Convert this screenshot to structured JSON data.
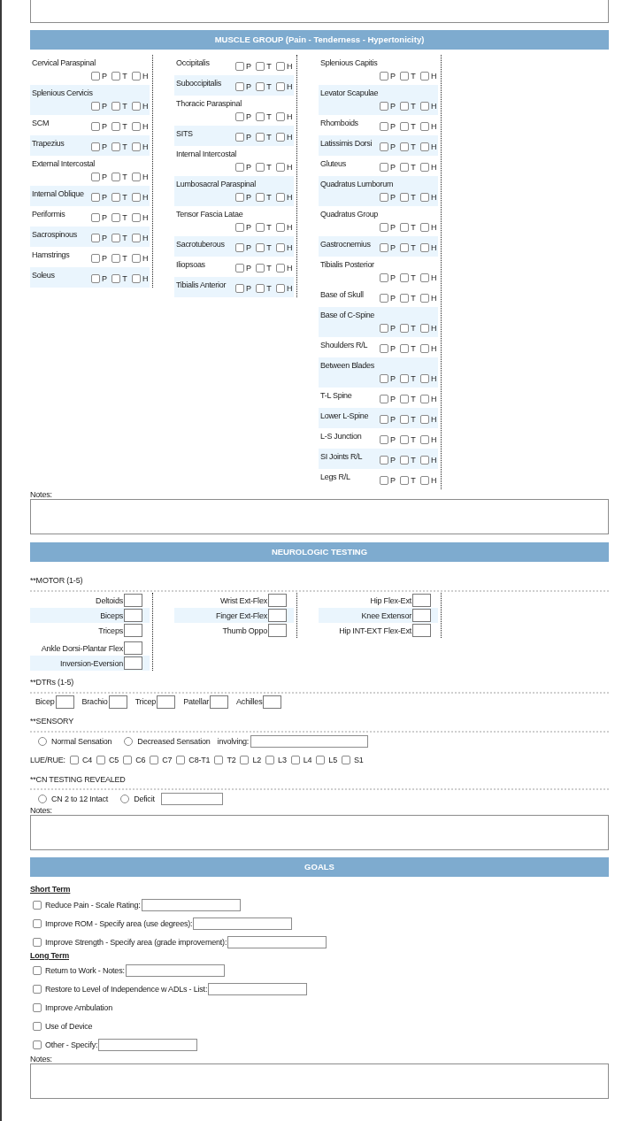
{
  "muscle_group": {
    "title": "MUSCLE GROUP (Pain - Tenderness - Hypertonicity)",
    "columns": [
      {
        "blocks": [
          {
            "rows": [
              {
                "name": "Cervical Paraspinal",
                "checks": [
                  {
                    "label": "P",
                    "checked": false
                  },
                  {
                    "label": "T",
                    "checked": false
                  },
                  {
                    "label": "H",
                    "checked": false
                  }
                ]
              },
              {
                "name": "Splenious Cervicis",
                "checks": [
                  {
                    "label": "P",
                    "checked": false
                  },
                  {
                    "label": "T",
                    "checked": false
                  },
                  {
                    "label": "H",
                    "checked": false
                  }
                ]
              },
              {
                "name": "SCM",
                "checks": [
                  {
                    "label": "P",
                    "checked": false
                  },
                  {
                    "label": "T",
                    "checked": false
                  },
                  {
                    "label": "H",
                    "checked": false
                  }
                ]
              },
              {
                "name": "Trapezius",
                "checks": [
                  {
                    "label": "P",
                    "checked": false
                  },
                  {
                    "label": "T",
                    "checked": false
                  },
                  {
                    "label": "H",
                    "checked": false
                  }
                ]
              },
              {
                "name": "External Intercostal",
                "checks": [
                  {
                    "label": "P",
                    "checked": false
                  },
                  {
                    "label": "T",
                    "checked": false
                  },
                  {
                    "label": "H",
                    "checked": false
                  }
                ]
              },
              {
                "name": "Internal Oblique",
                "checks": [
                  {
                    "label": "P",
                    "checked": false
                  },
                  {
                    "label": "T",
                    "checked": false
                  },
                  {
                    "label": "H",
                    "checked": false
                  }
                ]
              },
              {
                "name": "Periformis",
                "checks": [
                  {
                    "label": "P",
                    "checked": false
                  },
                  {
                    "label": "T",
                    "checked": false
                  },
                  {
                    "label": "H",
                    "checked": false
                  }
                ]
              },
              {
                "name": "Sacrospinous",
                "checks": [
                  {
                    "label": "P",
                    "checked": false
                  },
                  {
                    "label": "T",
                    "checked": false
                  },
                  {
                    "label": "H",
                    "checked": false
                  }
                ]
              },
              {
                "name": "Hamstrings",
                "checks": [
                  {
                    "label": "P",
                    "checked": false
                  },
                  {
                    "label": "T",
                    "checked": false
                  },
                  {
                    "label": "H",
                    "checked": false
                  }
                ]
              },
              {
                "name": "Soleus",
                "checks": [
                  {
                    "label": "P",
                    "checked": false
                  },
                  {
                    "label": "T",
                    "checked": false
                  },
                  {
                    "label": "H",
                    "checked": false
                  }
                ]
              }
            ]
          }
        ]
      },
      {
        "blocks": [
          {
            "rows": [
              {
                "name": "Occipitalis",
                "checks": [
                  {
                    "label": "P",
                    "checked": false
                  },
                  {
                    "label": "T",
                    "checked": false
                  },
                  {
                    "label": "H",
                    "checked": false
                  }
                ]
              },
              {
                "name": "Suboccipitalis",
                "checks": [
                  {
                    "label": "P",
                    "checked": false
                  },
                  {
                    "label": "T",
                    "checked": false
                  },
                  {
                    "label": "H",
                    "checked": false
                  }
                ]
              },
              {
                "name": "Thoracic Paraspinal",
                "checks": [
                  {
                    "label": "P",
                    "checked": false
                  },
                  {
                    "label": "T",
                    "checked": false
                  },
                  {
                    "label": "H",
                    "checked": false
                  }
                ]
              },
              {
                "name": "SITS",
                "checks": [
                  {
                    "label": "P",
                    "checked": false
                  },
                  {
                    "label": "T",
                    "checked": false
                  },
                  {
                    "label": "H",
                    "checked": false
                  }
                ]
              },
              {
                "name": "Internal Intercostal",
                "checks": [
                  {
                    "label": "P",
                    "checked": false
                  },
                  {
                    "label": "T",
                    "checked": false
                  },
                  {
                    "label": "H",
                    "checked": false
                  }
                ]
              },
              {
                "name": "Lumbosacral Paraspinal",
                "checks": [
                  {
                    "label": "P",
                    "checked": false
                  },
                  {
                    "label": "T",
                    "checked": false
                  },
                  {
                    "label": "H",
                    "checked": false
                  }
                ]
              },
              {
                "name": "Tensor Fascia Latae",
                "checks": [
                  {
                    "label": "P",
                    "checked": false
                  },
                  {
                    "label": "T",
                    "checked": false
                  },
                  {
                    "label": "H",
                    "checked": false
                  }
                ]
              },
              {
                "name": "Sacrotuberous",
                "checks": [
                  {
                    "label": "P",
                    "checked": false
                  },
                  {
                    "label": "T",
                    "checked": false
                  },
                  {
                    "label": "H",
                    "checked": false
                  }
                ]
              },
              {
                "name": "Iliopsoas",
                "checks": [
                  {
                    "label": "P",
                    "checked": false
                  },
                  {
                    "label": "T",
                    "checked": false
                  },
                  {
                    "label": "H",
                    "checked": false
                  }
                ]
              },
              {
                "name": "Tibialis Anterior",
                "checks": [
                  {
                    "label": "P",
                    "checked": false
                  },
                  {
                    "label": "T",
                    "checked": false
                  },
                  {
                    "label": "H",
                    "checked": false
                  }
                ]
              }
            ]
          }
        ]
      },
      {
        "blocks": [
          {
            "rows": [
              {
                "name": "Splenious Capitis",
                "checks": [
                  {
                    "label": "P",
                    "checked": false
                  },
                  {
                    "label": "T",
                    "checked": false
                  },
                  {
                    "label": "H",
                    "checked": false
                  }
                ]
              },
              {
                "name": "Levator Scapulae",
                "checks": [
                  {
                    "label": "P",
                    "checked": false
                  },
                  {
                    "label": "T",
                    "checked": false
                  },
                  {
                    "label": "H",
                    "checked": false
                  }
                ]
              },
              {
                "name": "Rhomboids",
                "checks": [
                  {
                    "label": "P",
                    "checked": false
                  },
                  {
                    "label": "T",
                    "checked": false
                  },
                  {
                    "label": "H",
                    "checked": false
                  }
                ]
              },
              {
                "name": "Latissimis Dorsi",
                "checks": [
                  {
                    "label": "P",
                    "checked": false
                  },
                  {
                    "label": "T",
                    "checked": false
                  },
                  {
                    "label": "H",
                    "checked": false
                  }
                ]
              },
              {
                "name": "Gluteus",
                "checks": [
                  {
                    "label": "P",
                    "checked": false
                  },
                  {
                    "label": "T",
                    "checked": false
                  },
                  {
                    "label": "H",
                    "checked": false
                  }
                ]
              },
              {
                "name": "Quadratus Lumborum",
                "checks": [
                  {
                    "label": "P",
                    "checked": false
                  },
                  {
                    "label": "T",
                    "checked": false
                  },
                  {
                    "label": "H",
                    "checked": false
                  }
                ]
              },
              {
                "name": "Quadratus Group",
                "checks": [
                  {
                    "label": "P",
                    "checked": false
                  },
                  {
                    "label": "T",
                    "checked": false
                  },
                  {
                    "label": "H",
                    "checked": false
                  }
                ]
              },
              {
                "name": "Gastrocnemius",
                "checks": [
                  {
                    "label": "P",
                    "checked": false
                  },
                  {
                    "label": "T",
                    "checked": false
                  },
                  {
                    "label": "H",
                    "checked": false
                  }
                ]
              },
              {
                "name": "Tibialis Posterior",
                "checks": [
                  {
                    "label": "P",
                    "checked": false
                  },
                  {
                    "label": "T",
                    "checked": false
                  },
                  {
                    "label": "H",
                    "checked": false
                  }
                ]
              }
            ]
          },
          {
            "rows": [
              {
                "name": "Base of Skull",
                "checks": [
                  {
                    "label": "P",
                    "checked": false
                  },
                  {
                    "label": "T",
                    "checked": false
                  },
                  {
                    "label": "H",
                    "checked": false
                  }
                ]
              },
              {
                "name": "Base of C-Spine",
                "checks": [
                  {
                    "label": "P",
                    "checked": false
                  },
                  {
                    "label": "T",
                    "checked": false
                  },
                  {
                    "label": "H",
                    "checked": false
                  }
                ]
              },
              {
                "name": "Shoulders R/L",
                "checks": [
                  {
                    "label": "P",
                    "checked": false
                  },
                  {
                    "label": "T",
                    "checked": false
                  },
                  {
                    "label": "H",
                    "checked": false
                  }
                ]
              },
              {
                "name": "Between Blades",
                "checks": [
                  {
                    "label": "P",
                    "checked": false
                  },
                  {
                    "label": "T",
                    "checked": false
                  },
                  {
                    "label": "H",
                    "checked": false
                  }
                ]
              },
              {
                "name": "T-L Spine",
                "checks": [
                  {
                    "label": "P",
                    "checked": false
                  },
                  {
                    "label": "T",
                    "checked": false
                  },
                  {
                    "label": "H",
                    "checked": false
                  }
                ]
              },
              {
                "name": "Lower L-Spine",
                "checks": [
                  {
                    "label": "P",
                    "checked": false
                  },
                  {
                    "label": "T",
                    "checked": false
                  },
                  {
                    "label": "H",
                    "checked": false
                  }
                ]
              },
              {
                "name": "L-S Junction",
                "checks": [
                  {
                    "label": "P",
                    "checked": false
                  },
                  {
                    "label": "T",
                    "checked": false
                  },
                  {
                    "label": "H",
                    "checked": false
                  }
                ]
              },
              {
                "name": "SI Joints R/L",
                "checks": [
                  {
                    "label": "P",
                    "checked": false
                  },
                  {
                    "label": "T",
                    "checked": false
                  },
                  {
                    "label": "H",
                    "checked": false
                  }
                ]
              },
              {
                "name": "Legs R/L",
                "checks": [
                  {
                    "label": "P",
                    "checked": false
                  },
                  {
                    "label": "T",
                    "checked": false
                  },
                  {
                    "label": "H",
                    "checked": false
                  }
                ]
              }
            ]
          }
        ]
      }
    ],
    "notes_label": "Notes:"
  },
  "neurologic_testing": {
    "title": "NEUROLOGIC TESTING",
    "motor": {
      "heading": "**MOTOR (1-5)",
      "columns": [
        {
          "blocks": [
            {
              "rows": [
                {
                  "label": "Deltoids"
                },
                {
                  "label": "Biceps"
                },
                {
                  "label": "Triceps"
                }
              ]
            },
            {
              "rows": [
                {
                  "label": "Ankle Dorsi-Plantar Flex"
                },
                {
                  "label": "Inversion-Eversion"
                }
              ]
            }
          ]
        },
        {
          "blocks": [
            {
              "rows": [
                {
                  "label": "Wrist Ext-Flex"
                },
                {
                  "label": "Finger Ext-Flex"
                },
                {
                  "label": "Thumb Oppo"
                }
              ]
            }
          ]
        },
        {
          "blocks": [
            {
              "rows": [
                {
                  "label": "Hip Flex-Ext"
                },
                {
                  "label": "Knee Extensor"
                },
                {
                  "label": "Hip INT-EXT Flex-Ext"
                }
              ]
            }
          ]
        }
      ]
    },
    "dtrs": {
      "heading": "**DTRs (1-5)",
      "items": [
        {
          "label": "Bicep"
        },
        {
          "label": "Brachio"
        },
        {
          "label": "Tricep"
        },
        {
          "label": "Patellar"
        },
        {
          "label": "Achilles"
        }
      ]
    },
    "sensory": {
      "heading": "**SENSORY",
      "options": [
        {
          "label": "Normal Sensation",
          "selected": false
        },
        {
          "label": "Decreased Sensation",
          "selected": false
        }
      ],
      "involving_label": "involving:",
      "levels_label": "LUE/RUE:",
      "levels": [
        {
          "label": "C4",
          "checked": false
        },
        {
          "label": "C5",
          "checked": false
        },
        {
          "label": "C6",
          "checked": false
        },
        {
          "label": "C7",
          "checked": false
        },
        {
          "label": "C8-T1",
          "checked": false
        },
        {
          "label": "T2",
          "checked": false
        },
        {
          "label": "L2",
          "checked": false
        },
        {
          "label": "L3",
          "checked": false
        },
        {
          "label": "L4",
          "checked": false
        },
        {
          "label": "L5",
          "checked": false
        },
        {
          "label": "S1",
          "checked": false
        }
      ]
    },
    "cn_testing": {
      "heading": "**CN TESTING REVEALED",
      "options": [
        {
          "label": "CN 2 to 12 Intact",
          "selected": false
        },
        {
          "label": "Deficit",
          "selected": false
        }
      ]
    },
    "notes_label": "Notes:"
  },
  "goals": {
    "title": "GOALS",
    "groups": [
      {
        "heading": "Short Term",
        "items": [
          {
            "kind": "input",
            "label": "Reduce Pain - Scale Rating:",
            "checked": false
          },
          {
            "kind": "input",
            "label": "Improve ROM - Specify area (use degrees):",
            "checked": false
          },
          {
            "kind": "input",
            "label": "Improve Strength - Specify area (grade improvement):",
            "checked": false
          }
        ]
      },
      {
        "heading": "Long Term",
        "items": [
          {
            "kind": "input",
            "label": "Return to Work - Notes:",
            "checked": false
          },
          {
            "kind": "input",
            "label": "Restore to Level of Independence w ADLs - List:",
            "checked": false
          },
          {
            "kind": "check",
            "label": "Improve Ambulation",
            "checked": false
          },
          {
            "kind": "check",
            "label": "Use of Device",
            "checked": false
          },
          {
            "kind": "input",
            "label": "Other - Specify:",
            "checked": false
          }
        ]
      }
    ],
    "notes_label": "Notes:"
  }
}
